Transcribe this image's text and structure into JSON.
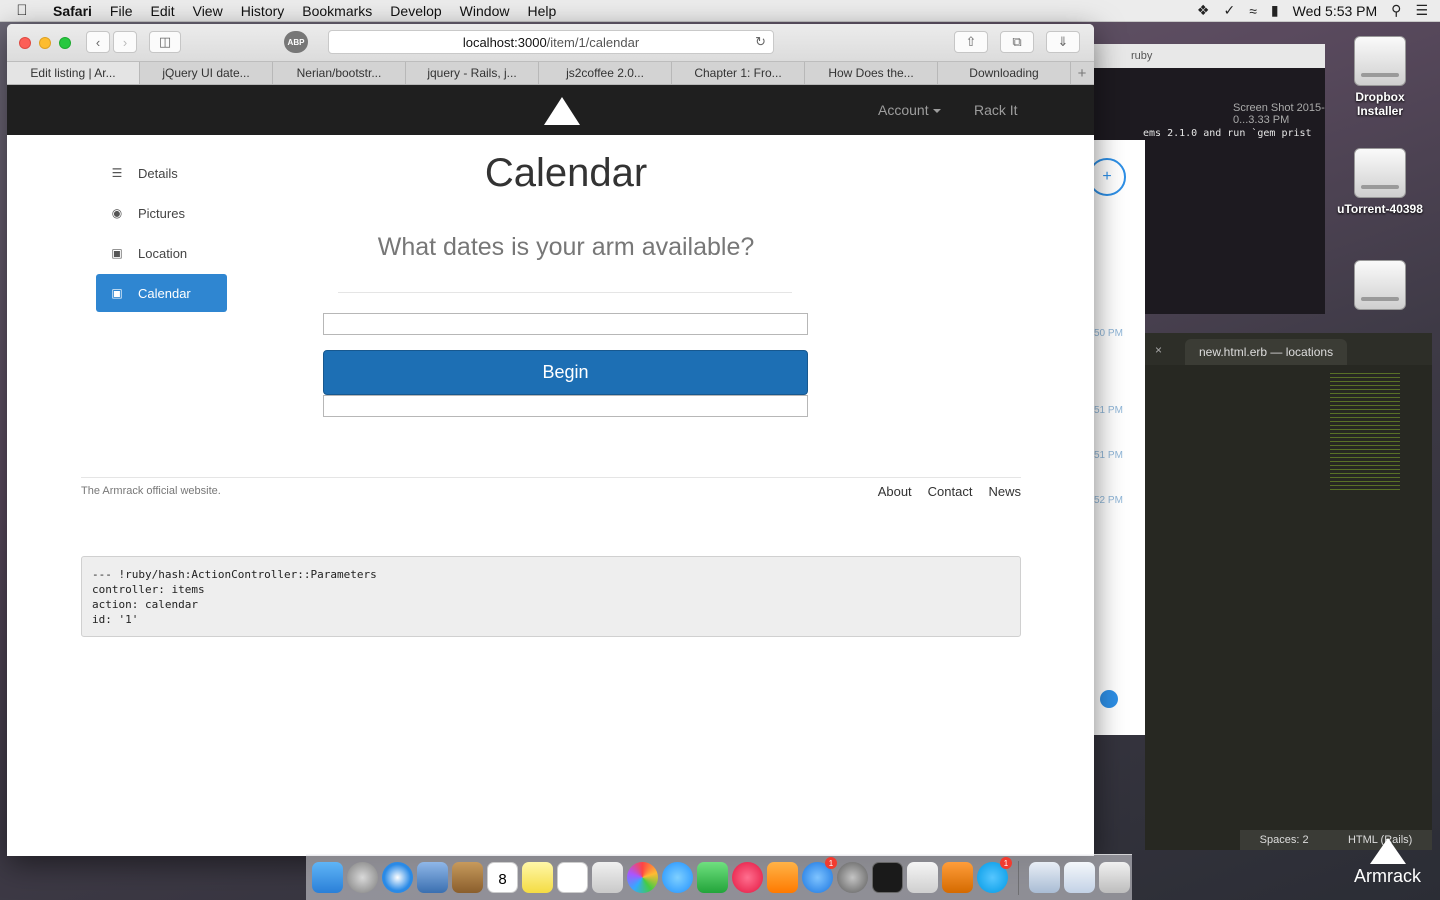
{
  "menubar": {
    "app_name": "Safari",
    "items": [
      "File",
      "Edit",
      "View",
      "History",
      "Bookmarks",
      "Develop",
      "Window",
      "Help"
    ],
    "clock": "Wed 5:53 PM"
  },
  "desktop": {
    "icons": [
      {
        "label": "Dropbox\nInstaller"
      },
      {
        "label": "uTorrent-40398"
      },
      {
        "label": ""
      }
    ],
    "terminal": {
      "title": "ruby",
      "command_text": "ems 2.1.0 and run `gem prist",
      "screenshot_label": "Screen Shot\n2015-0...3.33 PM"
    },
    "chat_times": [
      "50 PM",
      "51 PM",
      "51 PM",
      "52 PM"
    ],
    "editor": {
      "tab_label": "new.html.erb — locations",
      "status_spaces": "Spaces: 2",
      "status_syntax": "HTML (Rails)"
    }
  },
  "browser": {
    "url_host": "localhost:3000",
    "url_path": "/item/1/calendar",
    "tabs": [
      "Edit listing | Ar...",
      "jQuery UI date...",
      "Nerian/bootstr...",
      "jquery - Rails, j...",
      "js2coffee 2.0...",
      "Chapter 1: Fro...",
      "How Does the...",
      "Downloading"
    ]
  },
  "site": {
    "nav": {
      "account": "Account",
      "rack_it": "Rack It"
    },
    "sidebar": [
      {
        "label": "Details",
        "icon": "list-icon"
      },
      {
        "label": "Pictures",
        "icon": "camera-icon"
      },
      {
        "label": "Location",
        "icon": "lock-icon"
      },
      {
        "label": "Calendar",
        "icon": "lock-icon",
        "active": true
      }
    ],
    "title": "Calendar",
    "subtitle": "What dates is your arm available?",
    "begin_button": "Begin",
    "footer": {
      "text": "The Armrack official website.",
      "links": [
        "About",
        "Contact",
        "News"
      ]
    },
    "debug_lines": [
      "--- !ruby/hash:ActionController::Parameters",
      "controller: items",
      "action: calendar",
      "id: '1'"
    ]
  },
  "dock": {
    "badges": {
      "calendar_day": "8",
      "app_store": "1",
      "skype": "1"
    }
  },
  "brand": {
    "wordmark": "Armrack"
  },
  "colors": {
    "active_blue": "#2f86d1",
    "button_blue": "#1d6fb4",
    "navbar": "#1f1f1f"
  }
}
